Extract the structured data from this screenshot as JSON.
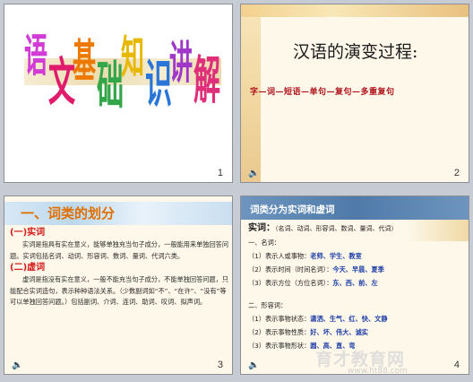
{
  "slides": [
    {
      "number": "1",
      "title_chars": [
        "语",
        "文",
        "基",
        "础",
        "知",
        "识",
        "讲",
        "解"
      ],
      "title_colors": [
        "#d23bd5",
        "#e01b6b",
        "#ed7a00",
        "#33a64a",
        "#e8b800",
        "#2a75d8",
        "#9f37c9",
        "#e02f7a"
      ]
    },
    {
      "number": "2",
      "title": "汉语的演变过程:",
      "sequence": "字—词—短语—单句—复句—多重复句",
      "footer_icon": "speaker-icon"
    },
    {
      "number": "3",
      "banner_title": "一、词类的划分",
      "sec1_title": "(一)实词",
      "sec1_text": "实词是指具有实在意义，能够单独充当句子成分，一般能用来单独回答问题。实词包括名词、动词、形容词、数词、量词、代词六类。",
      "sec2_title": "(二)虚词",
      "sec2_text": "虚词是指没有实在意义，一般不能充当句子成分，不能单独回答问题，只能配合实词造句，表示种种语法关系。（少数副词如“不”、“在许”、“没有”等可以单独回答问题。）包括副词、介词、连词、助词、叹词、拟声词。",
      "footer_icon": "speaker-icon"
    },
    {
      "number": "4",
      "top_title": "词类分为实词和虚词",
      "shici_label": "实词：",
      "shici_list": "（名词、动词、形容词、数词、量词、代词）",
      "mingci_title": "一、名词：",
      "mingci_rows": [
        {
          "label": "（1）表示人或事物：",
          "examples": "老师、学生、教室"
        },
        {
          "label": "（2）表示时间（时间名词）：",
          "examples": "今天、早晨、夏季"
        },
        {
          "label": "（3）表示方位（方位名词）：",
          "examples": "东、西、前、左"
        }
      ],
      "xingrong_title": "二、形容词：",
      "xingrong_rows": [
        {
          "label": "（1）表示事物状态：",
          "examples": "潇洒、生气、红、快、文静"
        },
        {
          "label": "（2）表示事物性质：",
          "examples": "好、坏、伟大、诚实"
        },
        {
          "label": "（3）表示事物形状：",
          "examples": "圆、高、直、弯"
        }
      ],
      "footer_icon": "speaker-icon"
    }
  ],
  "watermark": "育才教育网",
  "watermark_url": "www.ht88.com"
}
